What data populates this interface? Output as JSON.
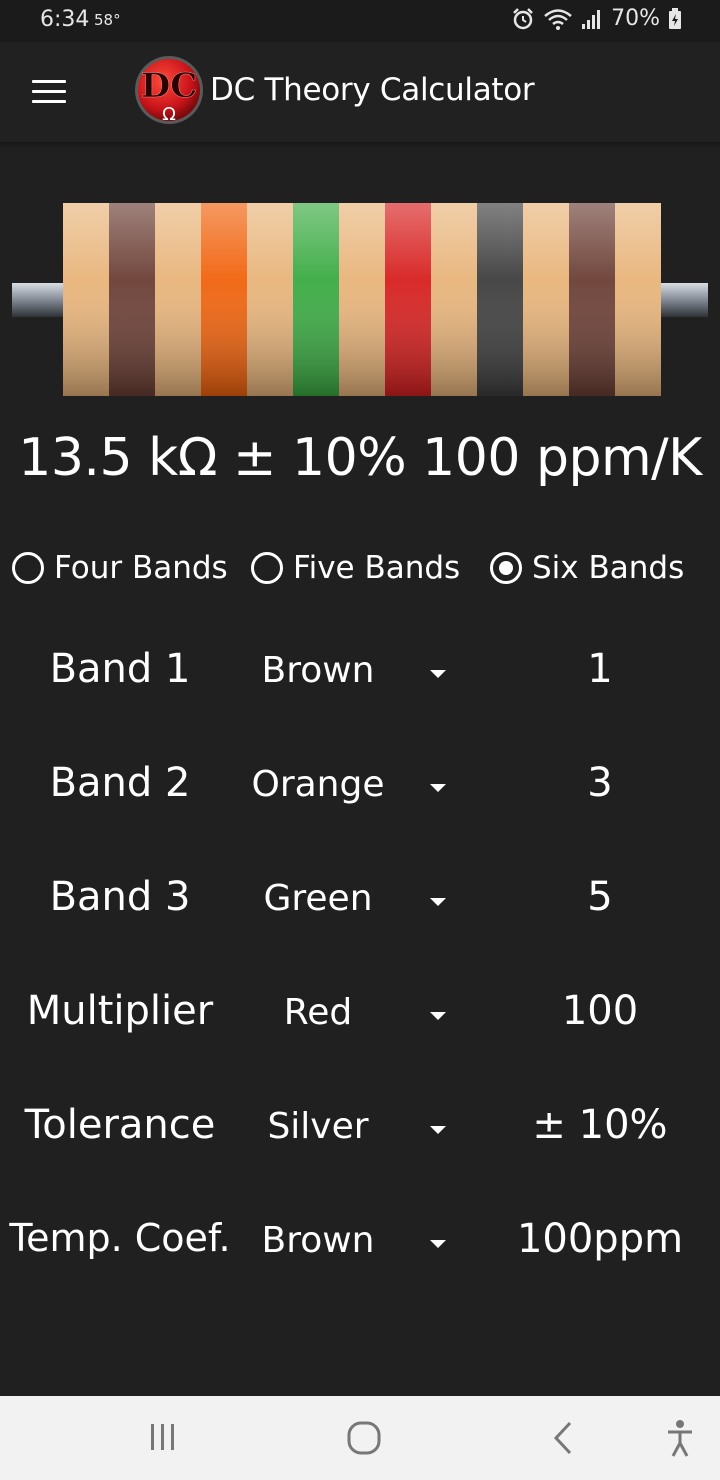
{
  "status_bar": {
    "time": "6:34",
    "temperature": "58°",
    "battery_percent": "70%",
    "icons": [
      "alarm-icon",
      "wifi-icon",
      "signal-icon",
      "battery-icon"
    ]
  },
  "app_bar": {
    "title": "DC Theory Calculator",
    "logo_text": "DC",
    "logo_symbol": "Ω",
    "menu_icon": "hamburger-menu-icon"
  },
  "resistor": {
    "body_color": "#e8b47a",
    "bands": [
      {
        "name": "Brown",
        "color": "#6b3e34"
      },
      {
        "name": "Orange",
        "color": "#f0620c"
      },
      {
        "name": "Green",
        "color": "#3aaa42"
      },
      {
        "name": "Red",
        "color": "#d71f1f"
      },
      {
        "name": "Silver",
        "color": "#3e3e3e"
      },
      {
        "name": "Brown",
        "color": "#6b3e34"
      }
    ]
  },
  "result": {
    "text": "13.5 kΩ ± 10% 100 ppm/K"
  },
  "band_count_options": [
    {
      "label": "Four Bands",
      "checked": false
    },
    {
      "label": "Five Bands",
      "checked": false
    },
    {
      "label": "Six Bands",
      "checked": true
    }
  ],
  "rows": [
    {
      "label": "Band 1",
      "selected": "Brown",
      "value": "1"
    },
    {
      "label": "Band 2",
      "selected": "Orange",
      "value": "3"
    },
    {
      "label": "Band 3",
      "selected": "Green",
      "value": "5"
    },
    {
      "label": "Multiplier",
      "selected": "Red",
      "value": "100"
    },
    {
      "label": "Tolerance",
      "selected": "Silver",
      "value": "± 10%"
    },
    {
      "label": "Temp. Coef.",
      "selected": "Brown",
      "value": "100ppm"
    }
  ],
  "nav_bar": {
    "buttons": [
      "recent-apps-icon",
      "home-icon",
      "back-icon",
      "accessibility-icon"
    ]
  }
}
